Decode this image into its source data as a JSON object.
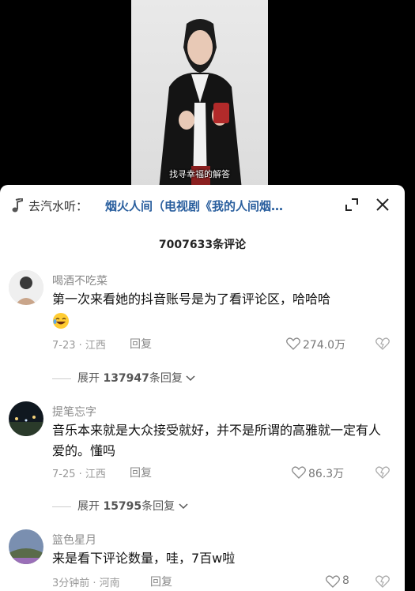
{
  "video": {
    "subtitle": "找寻幸福的解答"
  },
  "music": {
    "prefix": "去汽水听：",
    "title": "烟火人间（电视剧《我的人间烟…"
  },
  "comments_header": {
    "count": "7007633条评论"
  },
  "comments": [
    {
      "username": "喝酒不吃菜",
      "text": "第一次来看她的抖音账号是为了看评论区，哈哈哈",
      "meta": "7-23 · 江西",
      "reply_label": "回复",
      "likes": "274.0万",
      "expand_label": "展开",
      "expand_count": "137947",
      "expand_suffix": "条回复"
    },
    {
      "username": "提笔忘字",
      "text": "音乐本来就是大众接受就好，并不是所谓的高雅就一定有人爱的。懂吗",
      "meta": "7-25 · 江西",
      "reply_label": "回复",
      "likes": "86.3万",
      "expand_label": "展开",
      "expand_count": "15795",
      "expand_suffix": "条回复"
    },
    {
      "username": "篮色星月",
      "text": "来是看下评论数量，哇，7百w啦",
      "meta": "3分钟前 · 河南",
      "reply_label": "回复",
      "likes": "8"
    }
  ],
  "icons": {
    "note": "music-note-icon",
    "expand": "expand-icon",
    "close": "close-icon",
    "heart": "heart-icon",
    "dislike": "dislike-icon",
    "chevron": "chevron-down-icon",
    "emoji": "laughing-emoji-icon"
  },
  "colors": {
    "link": "#2a5f9e",
    "muted": "#999999",
    "text": "#111111"
  }
}
